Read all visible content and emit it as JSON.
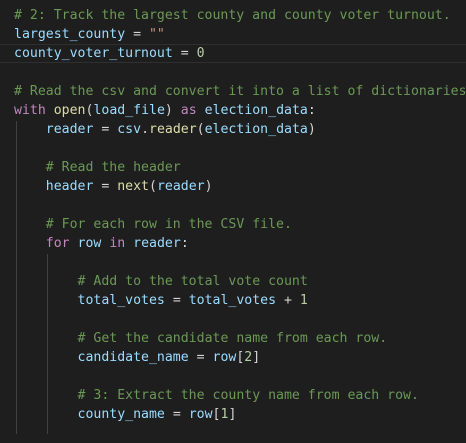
{
  "editor": {
    "lines": [
      [
        {
          "t": "# 2: Track the largest county and county voter turnout.",
          "c": "comment"
        }
      ],
      [
        {
          "t": "largest_county",
          "c": "var"
        },
        {
          "t": " = ",
          "c": "op"
        },
        {
          "t": "\"\"",
          "c": "string"
        }
      ],
      [
        {
          "t": "county_voter_turnout",
          "c": "var"
        },
        {
          "t": " = ",
          "c": "op"
        },
        {
          "t": "0",
          "c": "number"
        }
      ],
      [],
      [
        {
          "t": "# Read the csv and convert it into a list of dictionaries",
          "c": "comment"
        }
      ],
      [
        {
          "t": "with",
          "c": "keyword"
        },
        {
          "t": " ",
          "c": "plain"
        },
        {
          "t": "open",
          "c": "func"
        },
        {
          "t": "(",
          "c": "plain"
        },
        {
          "t": "load_file",
          "c": "var"
        },
        {
          "t": ") ",
          "c": "plain"
        },
        {
          "t": "as",
          "c": "keyword"
        },
        {
          "t": " ",
          "c": "plain"
        },
        {
          "t": "election_data",
          "c": "var"
        },
        {
          "t": ":",
          "c": "plain"
        }
      ],
      [
        {
          "t": "    ",
          "c": "plain"
        },
        {
          "t": "reader",
          "c": "var"
        },
        {
          "t": " = ",
          "c": "op"
        },
        {
          "t": "csv",
          "c": "var"
        },
        {
          "t": ".",
          "c": "plain"
        },
        {
          "t": "reader",
          "c": "func"
        },
        {
          "t": "(",
          "c": "plain"
        },
        {
          "t": "election_data",
          "c": "var"
        },
        {
          "t": ")",
          "c": "plain"
        }
      ],
      [],
      [
        {
          "t": "    ",
          "c": "plain"
        },
        {
          "t": "# Read the header",
          "c": "comment"
        }
      ],
      [
        {
          "t": "    ",
          "c": "plain"
        },
        {
          "t": "header",
          "c": "var"
        },
        {
          "t": " = ",
          "c": "op"
        },
        {
          "t": "next",
          "c": "func"
        },
        {
          "t": "(",
          "c": "plain"
        },
        {
          "t": "reader",
          "c": "var"
        },
        {
          "t": ")",
          "c": "plain"
        }
      ],
      [],
      [
        {
          "t": "    ",
          "c": "plain"
        },
        {
          "t": "# For each row in the CSV file.",
          "c": "comment"
        }
      ],
      [
        {
          "t": "    ",
          "c": "plain"
        },
        {
          "t": "for",
          "c": "keyword"
        },
        {
          "t": " ",
          "c": "plain"
        },
        {
          "t": "row",
          "c": "var"
        },
        {
          "t": " ",
          "c": "plain"
        },
        {
          "t": "in",
          "c": "keyword"
        },
        {
          "t": " ",
          "c": "plain"
        },
        {
          "t": "reader",
          "c": "var"
        },
        {
          "t": ":",
          "c": "plain"
        }
      ],
      [],
      [
        {
          "t": "        ",
          "c": "plain"
        },
        {
          "t": "# Add to the total vote count",
          "c": "comment"
        }
      ],
      [
        {
          "t": "        ",
          "c": "plain"
        },
        {
          "t": "total_votes",
          "c": "var"
        },
        {
          "t": " = ",
          "c": "op"
        },
        {
          "t": "total_votes",
          "c": "var"
        },
        {
          "t": " + ",
          "c": "op"
        },
        {
          "t": "1",
          "c": "number"
        }
      ],
      [],
      [
        {
          "t": "        ",
          "c": "plain"
        },
        {
          "t": "# Get the candidate name from each row.",
          "c": "comment"
        }
      ],
      [
        {
          "t": "        ",
          "c": "plain"
        },
        {
          "t": "candidate_name",
          "c": "var"
        },
        {
          "t": " = ",
          "c": "op"
        },
        {
          "t": "row",
          "c": "var"
        },
        {
          "t": "[",
          "c": "plain"
        },
        {
          "t": "2",
          "c": "number"
        },
        {
          "t": "]",
          "c": "plain"
        }
      ],
      [],
      [
        {
          "t": "        ",
          "c": "plain"
        },
        {
          "t": "# 3: Extract the county name from each row.",
          "c": "comment"
        }
      ],
      [
        {
          "t": "        ",
          "c": "plain"
        },
        {
          "t": "county_name",
          "c": "var"
        },
        {
          "t": " = ",
          "c": "op"
        },
        {
          "t": "row",
          "c": "var"
        },
        {
          "t": "[",
          "c": "plain"
        },
        {
          "t": "1",
          "c": "number"
        },
        {
          "t": "]",
          "c": "plain"
        }
      ],
      []
    ],
    "active_line": 2,
    "colors": {
      "background": "#1e1e1e",
      "comment": "#6a9955",
      "keyword": "#c586c0",
      "variable": "#9cdcfe",
      "function": "#dcdcaa",
      "string": "#ce9178",
      "number": "#b5cea8",
      "plain": "#d4d4d4",
      "indent_guide": "#404040",
      "active_line_border": "#2f2f2f"
    }
  }
}
